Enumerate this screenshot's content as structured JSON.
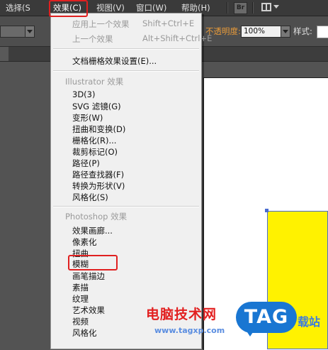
{
  "menubar": {
    "items": [
      "选择(S",
      "效果(C)",
      "视图(V)",
      "窗口(W)",
      "帮助(H)"
    ],
    "br_label": "Br"
  },
  "controlbar": {
    "opacity_label": "不透明度:",
    "opacity_value": "100%",
    "style_label": "样式:"
  },
  "effects_menu": {
    "apply_last": "应用上一个效果",
    "apply_last_shortcut": "Shift+Ctrl+E",
    "last_effect": "上一个效果",
    "last_effect_shortcut": "Alt+Shift+Ctrl+E",
    "document_raster": "文档栅格效果设置(E)...",
    "illustrator_heading": "Illustrator 效果",
    "illustrator_items": [
      "3D(3)",
      "SVG 滤镜(G)",
      "变形(W)",
      "扭曲和变换(D)",
      "栅格化(R)...",
      "裁剪标记(O)",
      "路径(P)",
      "路径查找器(F)",
      "转换为形状(V)",
      "风格化(S)"
    ],
    "photoshop_heading": "Photoshop 效果",
    "photoshop_items": [
      "效果画廊...",
      "像素化",
      "扭曲",
      "模糊",
      "画笔描边",
      "素描",
      "纹理",
      "艺术效果",
      "视频",
      "风格化"
    ]
  },
  "watermark": {
    "site_name": "电脑技术网",
    "url": "www.tagxp.com",
    "logo": "TAG",
    "side_text": "载站"
  },
  "colors": {
    "highlight": "#e02020",
    "artwork_fill": "#fff200",
    "selection": "#4a6cd0"
  }
}
